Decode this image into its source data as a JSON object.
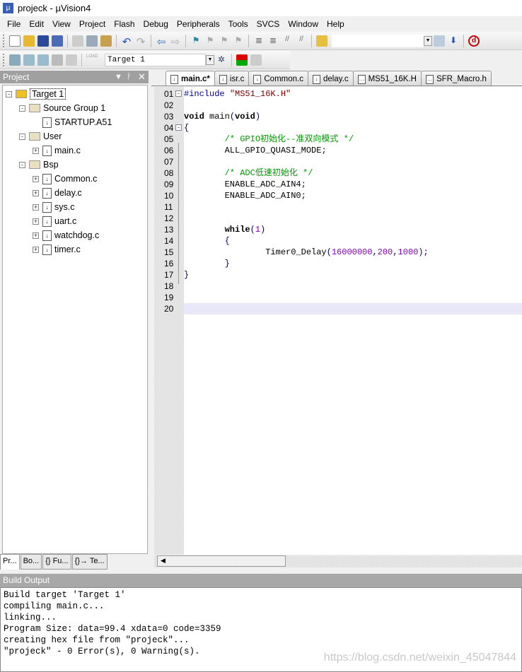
{
  "window": {
    "title": "projeck  - µVision4"
  },
  "menu": [
    "File",
    "Edit",
    "View",
    "Project",
    "Flash",
    "Debug",
    "Peripherals",
    "Tools",
    "SVCS",
    "Window",
    "Help"
  ],
  "toolbar2": {
    "target_select": "Target 1",
    "load_label": "LOAD"
  },
  "project_panel": {
    "title": "Project",
    "tree": [
      {
        "label": "Target 1",
        "level": 0,
        "type": "target",
        "expand": "-"
      },
      {
        "label": "Source Group 1",
        "level": 1,
        "type": "folder",
        "expand": "-"
      },
      {
        "label": "STARTUP.A51",
        "level": 2,
        "type": "file",
        "expand": ""
      },
      {
        "label": "User",
        "level": 1,
        "type": "folder",
        "expand": "-"
      },
      {
        "label": "main.c",
        "level": 2,
        "type": "file",
        "expand": "+"
      },
      {
        "label": "Bsp",
        "level": 1,
        "type": "folder",
        "expand": "-"
      },
      {
        "label": "Common.c",
        "level": 2,
        "type": "file",
        "expand": "+"
      },
      {
        "label": "delay.c",
        "level": 2,
        "type": "file",
        "expand": "+"
      },
      {
        "label": "sys.c",
        "level": 2,
        "type": "file",
        "expand": "+"
      },
      {
        "label": "uart.c",
        "level": 2,
        "type": "file",
        "expand": "+"
      },
      {
        "label": "watchdog.c",
        "level": 2,
        "type": "file",
        "expand": "+"
      },
      {
        "label": "timer.c",
        "level": 2,
        "type": "file",
        "expand": "+"
      }
    ],
    "tabs": [
      "Pr...",
      "Bo...",
      "{} Fu...",
      "{}→ Te..."
    ]
  },
  "editor": {
    "tabs": [
      {
        "label": "main.c*",
        "active": true
      },
      {
        "label": "isr.c"
      },
      {
        "label": "Common.c"
      },
      {
        "label": "delay.c"
      },
      {
        "label": "MS51_16K.H"
      },
      {
        "label": "SFR_Macro.h"
      }
    ],
    "current_line": 20,
    "lines": [
      [
        {
          "t": "#include ",
          "c": "pp"
        },
        {
          "t": "\"MS51_16K.H\"",
          "c": "s"
        }
      ],
      [],
      [
        {
          "t": "void",
          "c": "k"
        },
        {
          "t": " main",
          "c": ""
        },
        {
          "t": "(",
          "c": "p"
        },
        {
          "t": "void",
          "c": "k"
        },
        {
          "t": ")",
          "c": "p"
        }
      ],
      [
        {
          "t": "{",
          "c": "p"
        }
      ],
      [
        {
          "t": "        /* GPIO初始化--准双向模式 */",
          "c": "cm"
        }
      ],
      [
        {
          "t": "        ALL_GPIO_QUASI_MODE",
          "c": ""
        },
        {
          "t": ";",
          "c": "p"
        }
      ],
      [],
      [
        {
          "t": "        /* ADC低速初始化 */",
          "c": "cm"
        }
      ],
      [
        {
          "t": "        ENABLE_ADC_AIN4",
          "c": ""
        },
        {
          "t": ";",
          "c": "p"
        }
      ],
      [
        {
          "t": "        ENABLE_ADC_AIN0",
          "c": ""
        },
        {
          "t": ";",
          "c": "p"
        }
      ],
      [],
      [],
      [
        {
          "t": "        while",
          "c": "k"
        },
        {
          "t": "(",
          "c": "p"
        },
        {
          "t": "1",
          "c": "n"
        },
        {
          "t": ")",
          "c": "p"
        }
      ],
      [
        {
          "t": "        {",
          "c": "p"
        }
      ],
      [
        {
          "t": "                Timer0_Delay",
          "c": ""
        },
        {
          "t": "(",
          "c": "p"
        },
        {
          "t": "16000000",
          "c": "n"
        },
        {
          "t": ",",
          "c": "p"
        },
        {
          "t": "200",
          "c": "n"
        },
        {
          "t": ",",
          "c": "p"
        },
        {
          "t": "1000",
          "c": "n"
        },
        {
          "t": ");",
          "c": "p"
        }
      ],
      [
        {
          "t": "        }",
          "c": "p"
        }
      ],
      [
        {
          "t": "}",
          "c": "p"
        }
      ],
      [],
      [],
      []
    ]
  },
  "build_output": {
    "title": "Build Output",
    "lines": [
      "Build target 'Target 1'",
      "compiling main.c...",
      "linking...",
      "Program Size: data=99.4 xdata=0 code=3359",
      "creating hex file from \"projeck\"...",
      "\"projeck\" - 0 Error(s), 0 Warning(s)."
    ]
  },
  "watermark": "https://blog.csdn.net/weixin_45047844"
}
